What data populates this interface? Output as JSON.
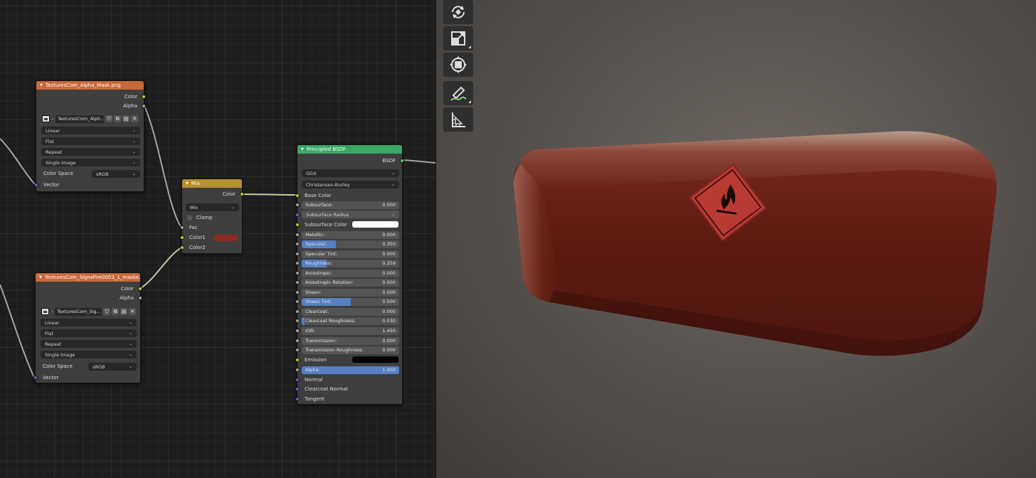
{
  "node_editor": {
    "image_node_1": {
      "title": "TexturesCom_Alpha_Mask.png",
      "outputs": [
        "Color",
        "Alpha"
      ],
      "image_name": "TexturesCom_Alph...",
      "interpolation": "Linear",
      "projection": "Flat",
      "extension": "Repeat",
      "source": "Single Image",
      "color_space_label": "Color Space",
      "color_space": "sRGB",
      "input": "Vector"
    },
    "image_node_2": {
      "title": "TexturesCom_SignsFire0003_1_maske...",
      "outputs": [
        "Color",
        "Alpha"
      ],
      "image_name": "TexturesCom_Sig...",
      "interpolation": "Linear",
      "projection": "Flat",
      "extension": "Repeat",
      "source": "Single Image",
      "color_space_label": "Color Space",
      "color_space": "sRGB",
      "input": "Vector"
    },
    "mix_node": {
      "title": "Mix",
      "output": "Color",
      "blend_mode": "Mix",
      "clamp_label": "Clamp",
      "inputs": [
        "Fac",
        "Color1",
        "Color2"
      ],
      "color1_swatch": "#8b2a1f"
    },
    "bsdf_node": {
      "title": "Principled BSDF",
      "output": "BSDF",
      "distribution": "GGX",
      "subsurface_method": "Christensen-Burley",
      "base_color_label": "Base Color",
      "subsurface_radius_label": "Subsurface Radius",
      "subsurface_color_label": "Subsurface Color",
      "subsurface_color": "#ffffff",
      "emission_label": "Emission",
      "emission_color": "#000000",
      "fields": [
        {
          "label": "Subsurface:",
          "value": "0.000",
          "fill": 0.0
        },
        {
          "label": "Metallic:",
          "value": "0.000",
          "fill": 0.0
        },
        {
          "label": "Specular:",
          "value": "0.350",
          "fill": 0.35
        },
        {
          "label": "Specular Tint:",
          "value": "0.000",
          "fill": 0.0
        },
        {
          "label": "Roughness:",
          "value": "0.259",
          "fill": 0.259
        },
        {
          "label": "Anisotropic:",
          "value": "0.000",
          "fill": 0.0
        },
        {
          "label": "Anisotropic Rotation:",
          "value": "0.000",
          "fill": 0.0
        },
        {
          "label": "Sheen:",
          "value": "0.000",
          "fill": 0.0
        },
        {
          "label": "Sheen Tint:",
          "value": "0.500",
          "fill": 0.5
        },
        {
          "label": "Clearcoat:",
          "value": "0.000",
          "fill": 0.0
        },
        {
          "label": "Clearcoat Roughness:",
          "value": "0.030",
          "fill": 0.03
        },
        {
          "label": "IOR:",
          "value": "1.450",
          "fill": 0.0
        },
        {
          "label": "Transmission:",
          "value": "0.000",
          "fill": 0.0
        },
        {
          "label": "Transmission Roughness:",
          "value": "0.000",
          "fill": 0.0
        },
        {
          "label": "Alpha:",
          "value": "1.000",
          "fill": 1.0
        }
      ],
      "vector_inputs": [
        "Normal",
        "Clearcoat Normal",
        "Tangent"
      ]
    }
  },
  "viewport": {
    "tools": [
      "rotate-tool-icon",
      "scale-tool-icon",
      "transform-tool-icon",
      "annotate-tool-icon",
      "measure-tool-icon"
    ],
    "object_color": "#6a1c14",
    "sign_color": "#c93a35"
  },
  "colors": {
    "socket_color": "#c7c729",
    "socket_float": "#a1a1a1",
    "socket_vector": "#6363c7",
    "socket_shader": "#63c763",
    "slider_fill": "#5680c2"
  }
}
